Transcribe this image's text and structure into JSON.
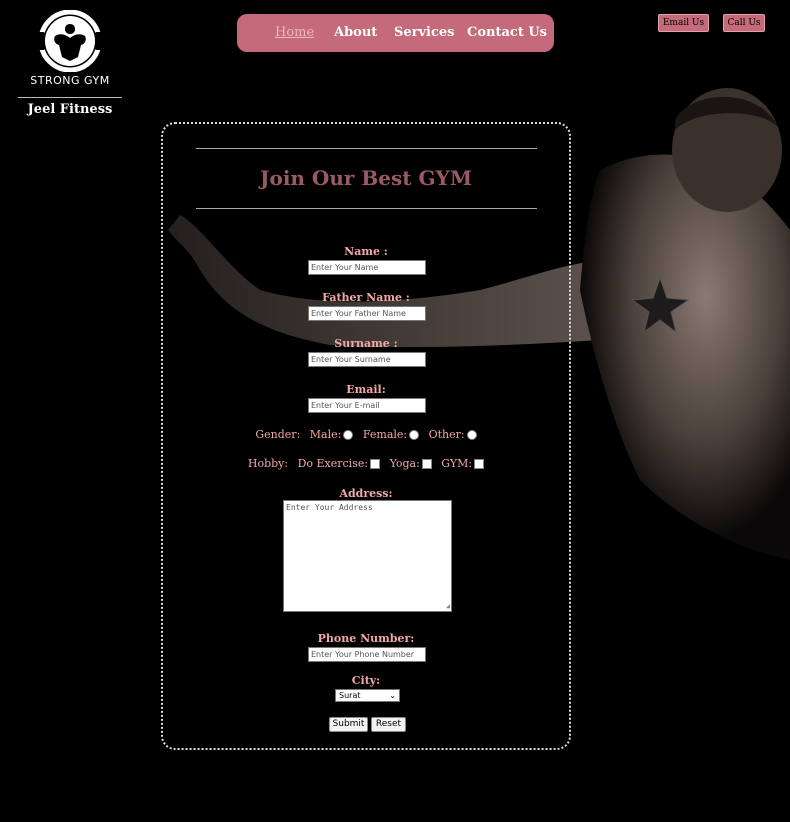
{
  "brand": {
    "logo_text": "STRONG GYM",
    "name": "Jeel Fitness"
  },
  "nav": {
    "items": [
      {
        "label": "Home",
        "active": true
      },
      {
        "label": "About"
      },
      {
        "label": "Services"
      },
      {
        "label": "Contact Us"
      }
    ]
  },
  "header_buttons": {
    "email": "Email Us",
    "call": "Call Us"
  },
  "form": {
    "title": "Join Our Best GYM",
    "name": {
      "label": "Name :",
      "placeholder": "Enter Your Name"
    },
    "father_name": {
      "label": "Father Name :",
      "placeholder": "Enter Your Father Name"
    },
    "surname": {
      "label": "Surname :",
      "placeholder": "Enter Your Surname"
    },
    "email": {
      "label": "Email:",
      "placeholder": "Enter Your E-mail"
    },
    "gender": {
      "label": "Gender:",
      "options": [
        "Male:",
        "Female:",
        "Other:"
      ]
    },
    "hobby": {
      "label": "Hobby:",
      "options": [
        "Do Exercise:",
        "Yoga:",
        "GYM:"
      ]
    },
    "address": {
      "label": "Address:",
      "placeholder": "Enter Your Address"
    },
    "phone": {
      "label": "Phone Number:",
      "placeholder": "Enter Your Phone Number"
    },
    "city": {
      "label": "City:",
      "selected": "Surat"
    },
    "submit": "Submit",
    "reset": "Reset"
  },
  "colors": {
    "accent": "#c46a7a",
    "label": "#f2a7a7",
    "title": "#9a5a64",
    "background": "#000000"
  }
}
